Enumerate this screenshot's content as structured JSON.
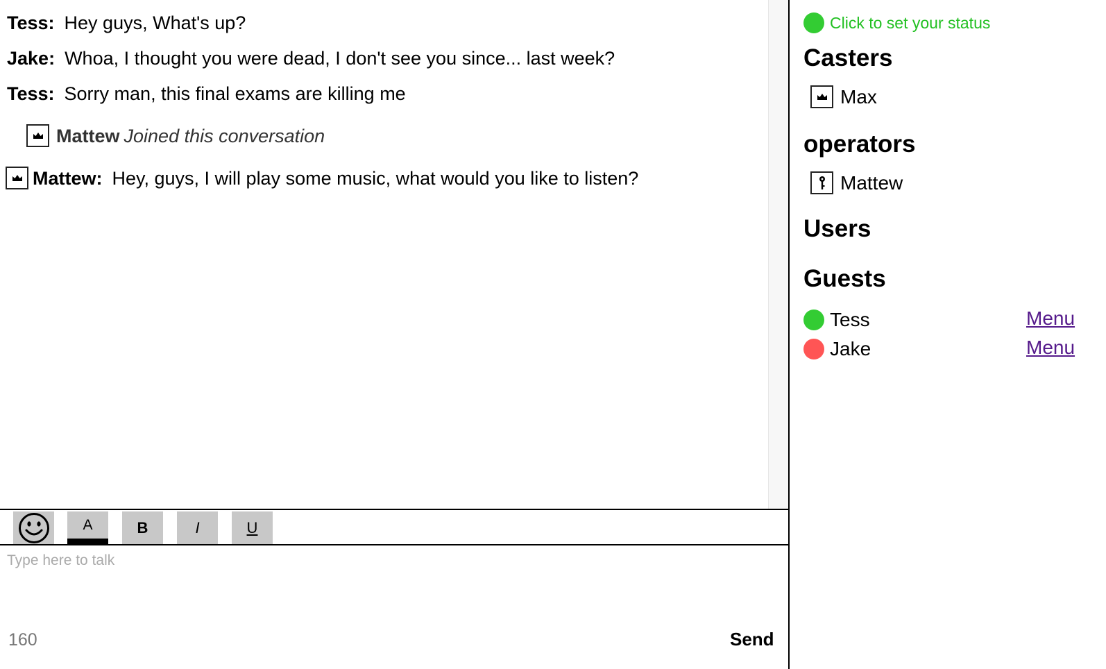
{
  "messages": [
    {
      "sender": "Tess:",
      "text": "Hey guys, What's up?"
    },
    {
      "sender": "Jake:",
      "text": "Whoa, I thought you were dead, I don't see you since... last week?"
    },
    {
      "sender": "Tess:",
      "text": "Sorry man, this final exams are killing me"
    },
    {
      "sender": "Mattew:",
      "text": "Hey, guys, I will play some music, what would you like to listen?",
      "badge_icon": "crown-icon"
    }
  ],
  "system_message": {
    "name": "Mattew",
    "text": "Joined this conversation",
    "badge_icon": "crown-icon"
  },
  "toolbar": {
    "emoji_icon": "smiley-icon",
    "color_label": "A",
    "bold_label": "B",
    "italic_label": "I",
    "underline_label": "U",
    "active_color": "#000000"
  },
  "input": {
    "placeholder": "Type here to talk",
    "value": ""
  },
  "char_count": "160",
  "send_label": "Send",
  "status": {
    "text": "Click to set your status",
    "color": "#33cc33"
  },
  "sections": {
    "casters": {
      "title": "Casters",
      "users": [
        {
          "name": "Max",
          "icon": "crown-icon"
        }
      ]
    },
    "operators": {
      "title": "operators",
      "users": [
        {
          "name": "Mattew",
          "icon": "key-icon"
        }
      ]
    },
    "users": {
      "title": "Users",
      "users": []
    },
    "guests": {
      "title": "Guests",
      "users": [
        {
          "name": "Tess",
          "status_color": "#33cc33",
          "menu_label": "Menu"
        },
        {
          "name": "Jake",
          "status_color": "#ff5555",
          "menu_label": "Menu"
        }
      ]
    }
  }
}
